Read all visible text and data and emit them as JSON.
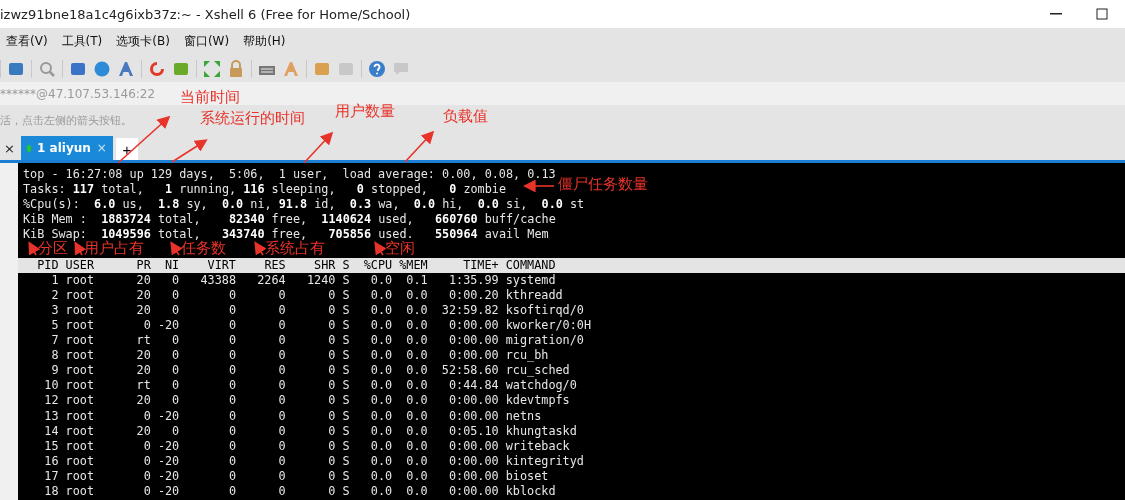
{
  "window": {
    "title": "izwz91bne18a1c4g6ixb37z:~ - Xshell 6 (Free for Home/School)"
  },
  "menu": [
    "查看(V)",
    "工具(T)",
    "选项卡(B)",
    "窗口(W)",
    "帮助(H)"
  ],
  "address": "******@47.107.53.146:22",
  "hint": "活，点击左侧的箭头按钮。",
  "tabs": [
    {
      "close": "×",
      "label": "1 aliyun",
      "connected": true,
      "selected": true
    }
  ],
  "tabs_left_close": "×",
  "new_tab": "+",
  "terminal": {
    "summary": [
      "top - 16:27:08 up 129 days,  5:06,  1 user,  load average: 0.00, 0.08, 0.13",
      "Tasks: **117** total,   **1** running, **116** sleeping,   **0** stopped,   **0** zombie",
      "%Cpu(s):  **6.0** us,  **1.8** sy,  **0.0** ni, **91.8** id,  **0.3** wa,  **0.0** hi,  **0.0** si,  **0.0** st",
      "KiB Mem :  **1883724** total,    **82340** free,  **1140624** used,   **660760** buff/cache",
      "KiB Swap:  **1049596** total,   **343740** free,   **705856** used.   **550964** avail Mem"
    ],
    "columns": [
      "PID",
      "USER",
      "PR",
      "NI",
      "VIRT",
      "RES",
      "SHR",
      "S",
      "%CPU",
      "%MEM",
      "TIME+",
      "COMMAND"
    ],
    "rows": [
      [
        "1",
        "root",
        "20",
        "0",
        "43388",
        "2264",
        "1240",
        "S",
        "0.0",
        "0.1",
        "1:35.99",
        "systemd"
      ],
      [
        "2",
        "root",
        "20",
        "0",
        "0",
        "0",
        "0",
        "S",
        "0.0",
        "0.0",
        "0:00.20",
        "kthreadd"
      ],
      [
        "3",
        "root",
        "20",
        "0",
        "0",
        "0",
        "0",
        "S",
        "0.0",
        "0.0",
        "32:59.82",
        "ksoftirqd/0"
      ],
      [
        "5",
        "root",
        "0",
        "-20",
        "0",
        "0",
        "0",
        "S",
        "0.0",
        "0.0",
        "0:00.00",
        "kworker/0:0H"
      ],
      [
        "7",
        "root",
        "rt",
        "0",
        "0",
        "0",
        "0",
        "S",
        "0.0",
        "0.0",
        "0:00.00",
        "migration/0"
      ],
      [
        "8",
        "root",
        "20",
        "0",
        "0",
        "0",
        "0",
        "S",
        "0.0",
        "0.0",
        "0:00.00",
        "rcu_bh"
      ],
      [
        "9",
        "root",
        "20",
        "0",
        "0",
        "0",
        "0",
        "S",
        "0.0",
        "0.0",
        "52:58.60",
        "rcu_sched"
      ],
      [
        "10",
        "root",
        "rt",
        "0",
        "0",
        "0",
        "0",
        "S",
        "0.0",
        "0.0",
        "0:44.84",
        "watchdog/0"
      ],
      [
        "12",
        "root",
        "20",
        "0",
        "0",
        "0",
        "0",
        "S",
        "0.0",
        "0.0",
        "0:00.00",
        "kdevtmpfs"
      ],
      [
        "13",
        "root",
        "0",
        "-20",
        "0",
        "0",
        "0",
        "S",
        "0.0",
        "0.0",
        "0:00.00",
        "netns"
      ],
      [
        "14",
        "root",
        "20",
        "0",
        "0",
        "0",
        "0",
        "S",
        "0.0",
        "0.0",
        "0:05.10",
        "khungtaskd"
      ],
      [
        "15",
        "root",
        "0",
        "-20",
        "0",
        "0",
        "0",
        "S",
        "0.0",
        "0.0",
        "0:00.00",
        "writeback"
      ],
      [
        "16",
        "root",
        "0",
        "-20",
        "0",
        "0",
        "0",
        "S",
        "0.0",
        "0.0",
        "0:00.00",
        "kintegrityd"
      ],
      [
        "17",
        "root",
        "0",
        "-20",
        "0",
        "0",
        "0",
        "S",
        "0.0",
        "0.0",
        "0:00.00",
        "bioset"
      ],
      [
        "18",
        "root",
        "0",
        "-20",
        "0",
        "0",
        "0",
        "S",
        "0.0",
        "0.0",
        "0:00.00",
        "kblockd"
      ]
    ]
  },
  "annotations": [
    "当前时间",
    "系统运行的时间",
    "用户数量",
    "负载值",
    "僵尸任务数量",
    "分区",
    "用户占有",
    "任务数",
    "系统占有",
    "空闲"
  ]
}
